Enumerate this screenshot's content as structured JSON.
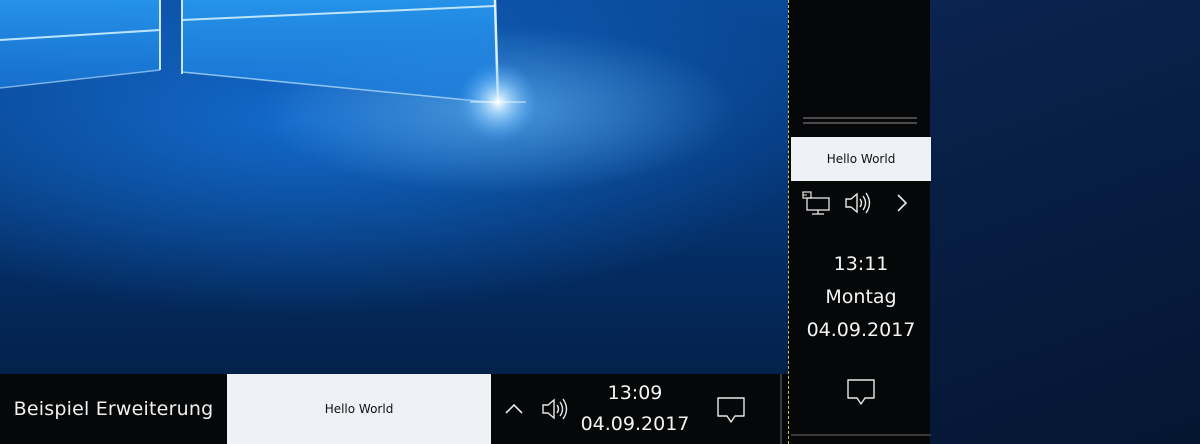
{
  "taskbar": {
    "title": "Beispiel Erweiterung",
    "hello_label": "Hello World",
    "time": "13:09",
    "date": "04.09.2017",
    "icons": {
      "overflow": "chevron-up-icon",
      "volume": "volume-icon",
      "notifications": "action-center-icon"
    }
  },
  "side_taskbar": {
    "hello_label": "Hello World",
    "time": "13:11",
    "weekday": "Montag",
    "date": "04.09.2017",
    "icons": {
      "network": "network-icon",
      "volume": "volume-icon",
      "more": "chevron-right-icon",
      "notifications": "action-center-icon"
    }
  },
  "colors": {
    "taskbar_bg": "#050708",
    "hello_bg": "#eef2f7",
    "wallpaper_blue": "#0a4a9a",
    "drag_outline": "#c8c84a"
  }
}
